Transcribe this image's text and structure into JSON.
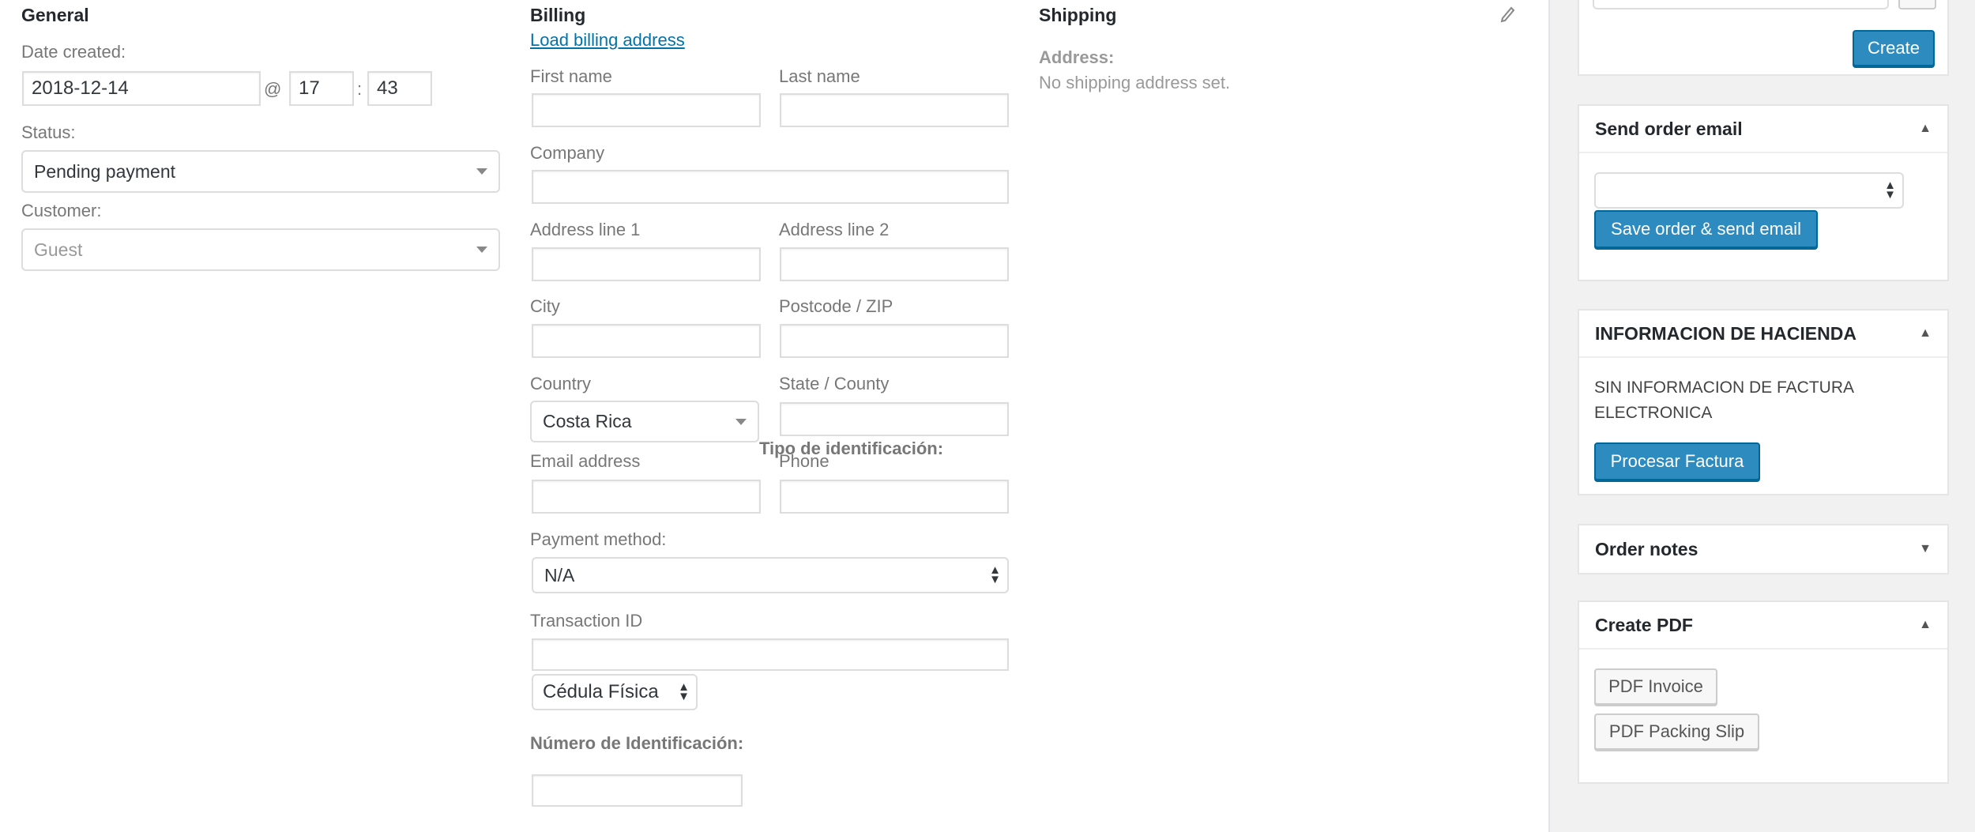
{
  "general": {
    "heading": "General",
    "date_created_label": "Date created:",
    "date_value": "2018-12-14",
    "at_sign": "@",
    "hour_value": "17",
    "colon": ":",
    "minute_value": "43",
    "status_label": "Status:",
    "status_value": "Pending payment",
    "customer_label": "Customer:",
    "customer_placeholder": "Guest"
  },
  "billing": {
    "heading": "Billing",
    "load_link": "Load billing address",
    "first_name_label": "First name",
    "last_name_label": "Last name",
    "company_label": "Company",
    "address1_label": "Address line 1",
    "address2_label": "Address line 2",
    "city_label": "City",
    "postcode_label": "Postcode / ZIP",
    "country_label": "Country",
    "country_value": "Costa Rica",
    "state_label": "State / County",
    "tipo_label": "Tipo de identificación:",
    "email_label": "Email address",
    "phone_label": "Phone",
    "payment_label": "Payment method:",
    "payment_value": "N/A",
    "transaction_label": "Transaction ID",
    "id_type_value": "Cédula Física",
    "id_number_label": "Número de Identificación:"
  },
  "shipping": {
    "heading": "Shipping",
    "address_label": "Address:",
    "address_value": "No shipping address set."
  },
  "sidebar": {
    "create_button": "Create",
    "send_email": {
      "title": "Send order email",
      "button": "Save order & send email"
    },
    "hacienda": {
      "title": "INFORMACION DE HACIENDA",
      "text": "SIN INFORMACION DE FACTURA ELECTRONICA",
      "button": "Procesar Factura"
    },
    "order_notes": {
      "title": "Order notes"
    },
    "create_pdf": {
      "title": "Create PDF",
      "invoice_button": "PDF Invoice",
      "packing_button": "PDF Packing Slip"
    }
  },
  "icons": {
    "edit": "pencil-icon",
    "collapse": "triangle-up-icon",
    "expand": "triangle-down-icon"
  },
  "colors": {
    "primary_button": "#2e8bc0",
    "link": "#0073aa",
    "sidebar_bg": "#f1f1f1"
  }
}
